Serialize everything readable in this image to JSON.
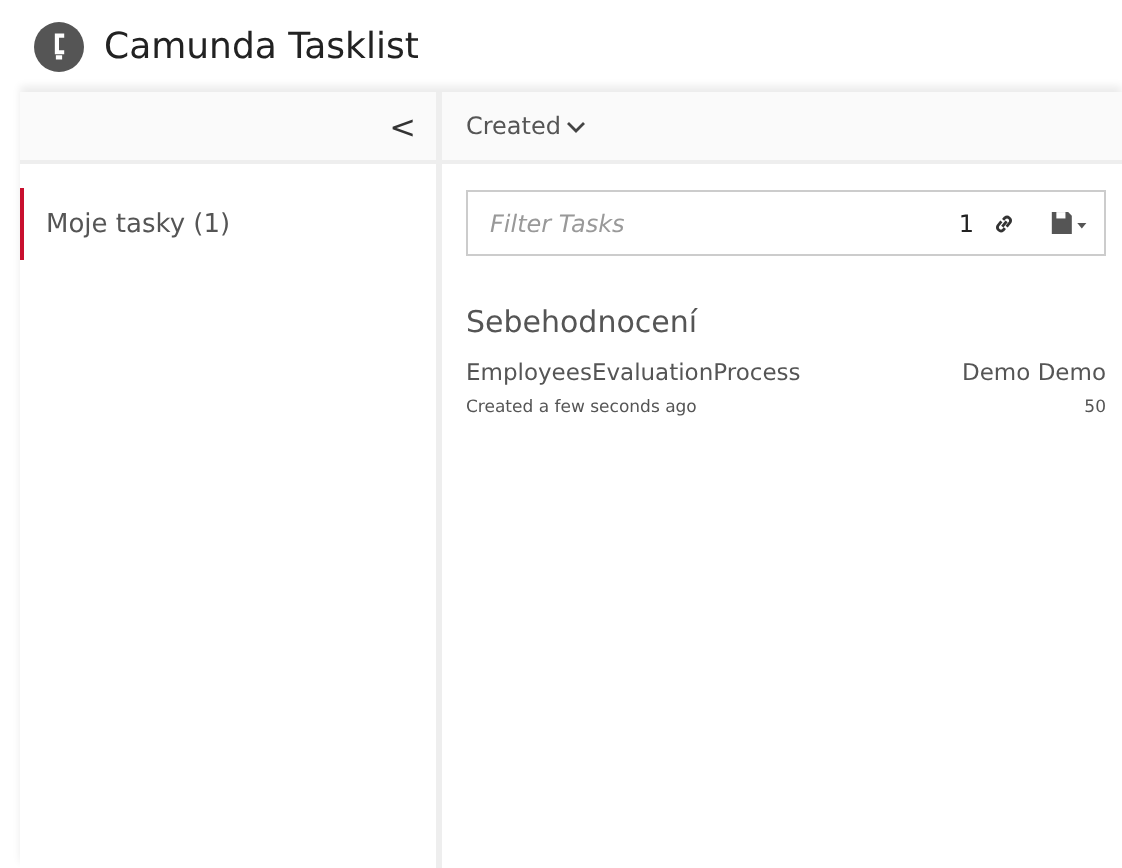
{
  "app": {
    "title": "Camunda Tasklist"
  },
  "sidebar": {
    "collapse": "<",
    "filters": [
      {
        "label": "Moje tasky (1)",
        "selected": true
      }
    ]
  },
  "sort": {
    "label": "Created"
  },
  "filter": {
    "placeholder": "Filter Tasks",
    "count": "1"
  },
  "tasks": [
    {
      "name": "Sebehodnocení",
      "process": "EmployeesEvaluationProcess",
      "assignee": "Demo Demo",
      "created": "Created a few seconds ago",
      "priority": "50",
      "selected": false
    }
  ]
}
